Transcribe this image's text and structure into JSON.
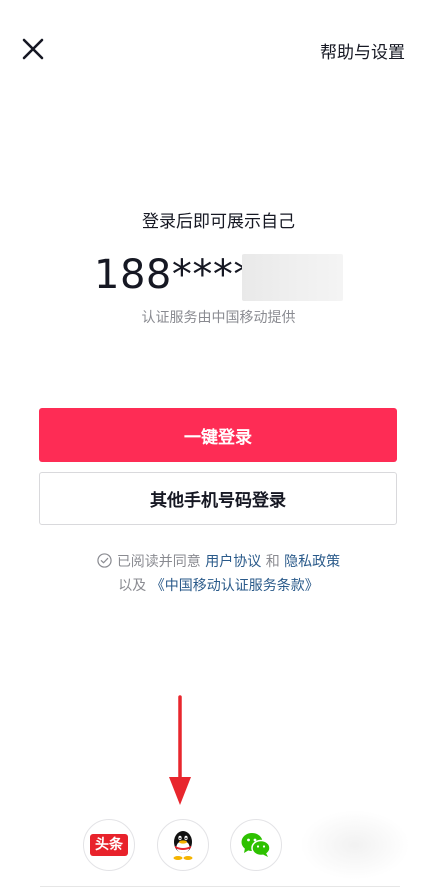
{
  "header": {
    "help_label": "帮助与设置"
  },
  "login": {
    "subtitle": "登录后即可展示自己",
    "phone_prefix": "188****",
    "provider_note": "认证服务由中国移动提供",
    "one_click_label": "一键登录",
    "other_phone_label": "其他手机号码登录"
  },
  "agreement": {
    "prefix": "已阅读并同意 ",
    "user_agreement": "用户协议",
    "and": " 和 ",
    "privacy_policy": "隐私政策",
    "line2_prefix": "以及 ",
    "cmcc_terms": "《中国移动认证服务条款》"
  },
  "social": {
    "toutiao_label": "头条",
    "icons": [
      "toutiao-icon",
      "qq-icon",
      "wechat-icon"
    ]
  },
  "colors": {
    "primary": "#fe2c55",
    "link": "#2a5a8a",
    "annotation_arrow": "#e8262d",
    "wechat": "#2dc100"
  }
}
